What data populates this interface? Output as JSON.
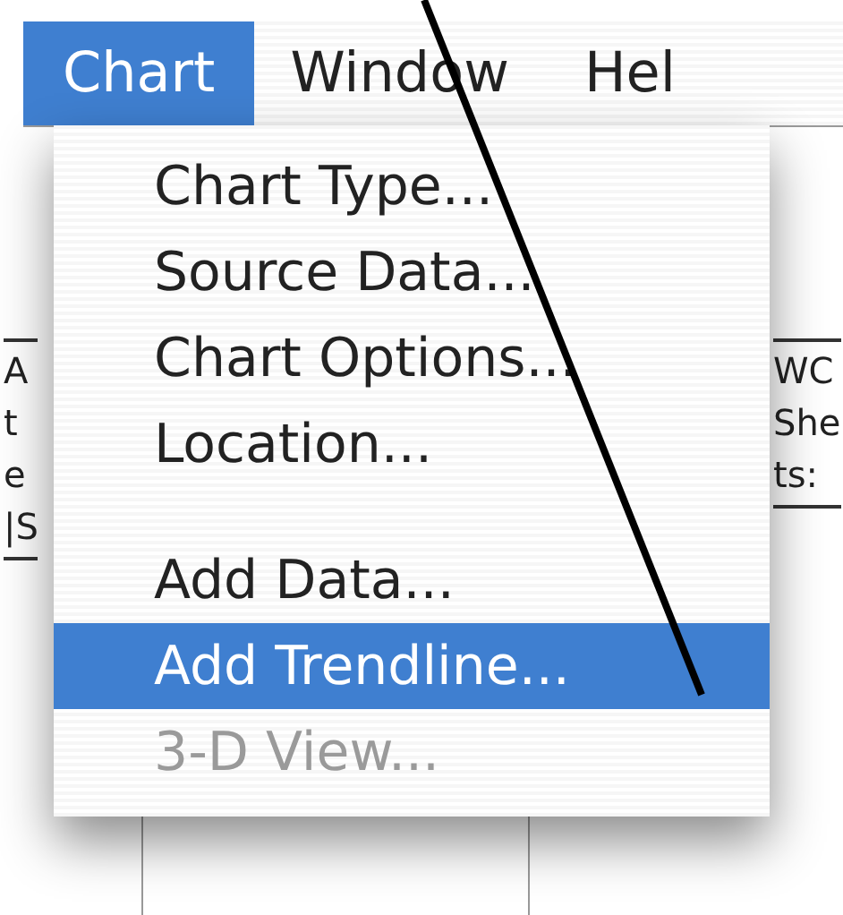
{
  "menu_bar": [
    {
      "label": "Chart",
      "selected": true
    },
    {
      "label": "Window",
      "selected": false
    },
    {
      "label": "Hel",
      "selected": false
    }
  ],
  "menu": {
    "items": [
      {
        "kind": "item",
        "label": "Chart Type...",
        "selected": false,
        "disabled": false
      },
      {
        "kind": "item",
        "label": "Source Data...",
        "selected": false,
        "disabled": false
      },
      {
        "kind": "item",
        "label": "Chart Options...",
        "selected": false,
        "disabled": false
      },
      {
        "kind": "item",
        "label": "Location...",
        "selected": false,
        "disabled": false
      },
      {
        "kind": "separator"
      },
      {
        "kind": "item",
        "label": "Add Data...",
        "selected": false,
        "disabled": false
      },
      {
        "kind": "item",
        "label": "Add Trendline...",
        "selected": true,
        "disabled": false
      },
      {
        "kind": "item",
        "label": "3-D View...",
        "selected": false,
        "disabled": true
      }
    ]
  },
  "background": {
    "left_fragments": [
      "A",
      "t",
      "e",
      "|S"
    ],
    "right_fragments": [
      "WC",
      "She",
      "ts:"
    ]
  }
}
